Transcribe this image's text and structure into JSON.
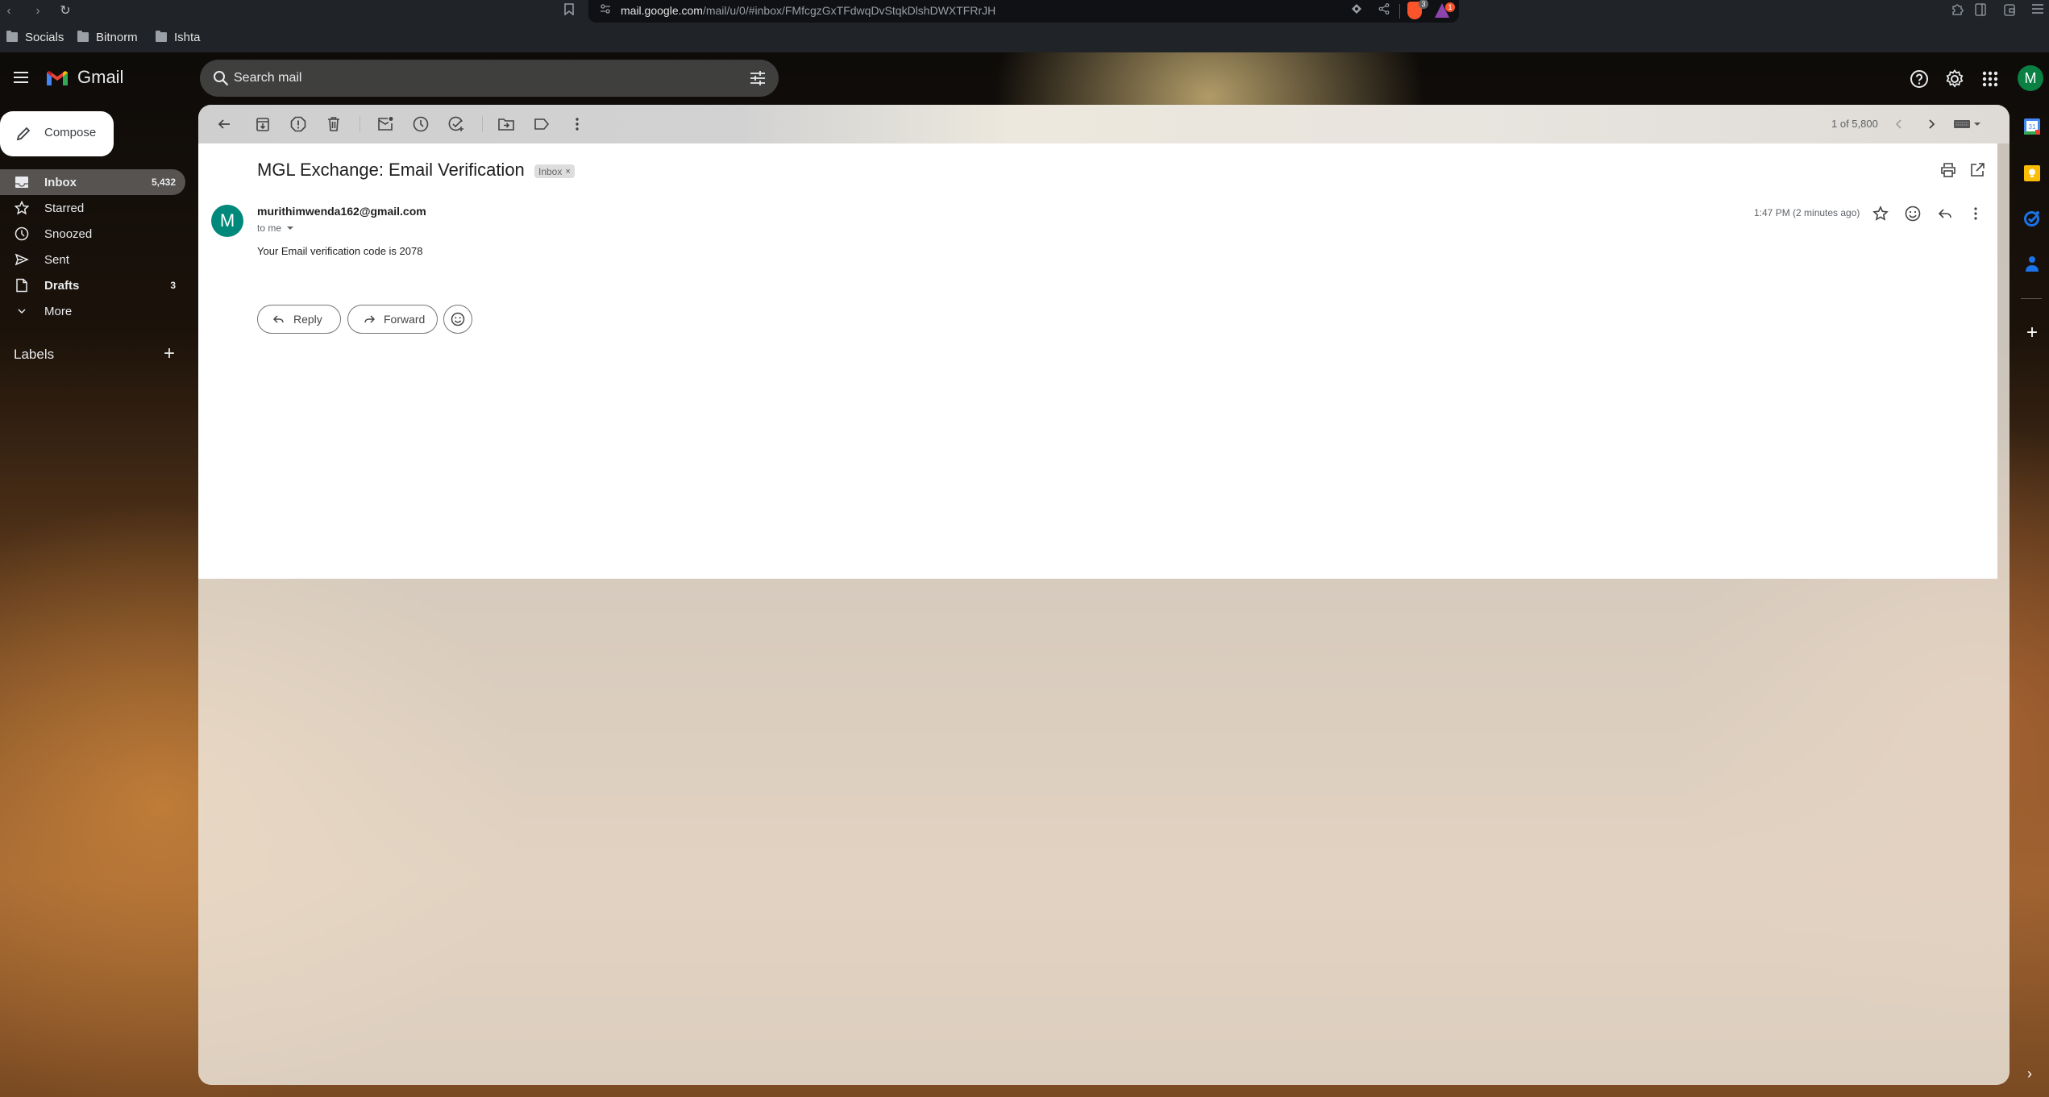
{
  "browser": {
    "url_host": "mail.google.com",
    "url_path": "/mail/u/0/#inbox/FMfcgzGxTFdwqDvStqkDlshDWXTFRrJH",
    "brave_shields_count": "3",
    "brave_rewards_count": "1",
    "bookmarks": [
      {
        "label": "Socials",
        "icon": "folder-icon"
      },
      {
        "label": "Bitnorm",
        "icon": "folder-icon"
      },
      {
        "label": "Ishta",
        "icon": "folder-icon"
      }
    ]
  },
  "header": {
    "app_name": "Gmail",
    "search_placeholder": "Search mail",
    "avatar_initial": "M",
    "icons": [
      "help-icon",
      "settings-gear-icon",
      "google-apps-grid-icon"
    ]
  },
  "sidebar": {
    "compose_label": "Compose",
    "items": [
      {
        "label": "Inbox",
        "count": "5,432",
        "icon": "inbox-icon",
        "active": true,
        "bold": true
      },
      {
        "label": "Starred",
        "count": "",
        "icon": "star-icon",
        "active": false,
        "bold": false
      },
      {
        "label": "Snoozed",
        "count": "",
        "icon": "clock-icon",
        "active": false,
        "bold": false
      },
      {
        "label": "Sent",
        "count": "",
        "icon": "send-icon",
        "active": false,
        "bold": false
      },
      {
        "label": "Drafts",
        "count": "3",
        "icon": "draft-icon",
        "active": false,
        "bold": true
      },
      {
        "label": "More",
        "count": "",
        "icon": "chevron-down-icon",
        "active": false,
        "bold": false
      }
    ],
    "labels_title": "Labels"
  },
  "toolbar": {
    "pager": "1 of 5,800",
    "actions": [
      "back",
      "archive",
      "report-spam",
      "delete",
      "mark-unread",
      "snooze",
      "add-to-tasks",
      "move-to",
      "labels",
      "more"
    ]
  },
  "email": {
    "subject": "MGL Exchange: Email Verification",
    "label_chip": "Inbox",
    "sender_initial": "M",
    "sender_email": "murithimwenda162@gmail.com",
    "recipient": "to me",
    "timestamp": "1:47 PM (2 minutes ago)",
    "body": "Your Email verification code is 2078",
    "reply_label": "Reply",
    "forward_label": "Forward"
  },
  "side_panel": {
    "apps": [
      "calendar",
      "keep",
      "tasks",
      "contacts"
    ],
    "calendar_day": "31"
  },
  "colors": {
    "avatar_green": "#0b8043",
    "sender_avatar_teal": "#00897b",
    "brave_orange": "#fb542b"
  }
}
